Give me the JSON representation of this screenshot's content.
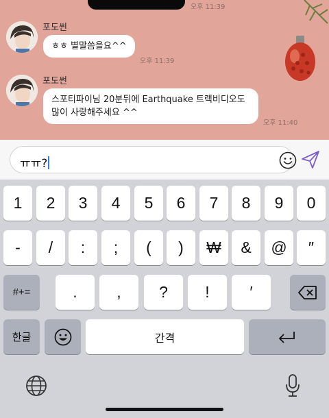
{
  "chat": {
    "top_time": "오후 11:39",
    "messages": [
      {
        "sender": "포도썬",
        "text": "ㅎㅎ 별말씀을요^^",
        "time": "오후 11:39"
      },
      {
        "sender": "포도썬",
        "line1": "스포티파이님 20분뒤에 Earthquake 트랙비디오도",
        "line2": "많이 사랑해주세요 ^^",
        "time": "오후 11:40"
      }
    ]
  },
  "input": {
    "value": "ㅠㅠ?"
  },
  "keyboard": {
    "row1": [
      "1",
      "2",
      "3",
      "4",
      "5",
      "6",
      "7",
      "8",
      "9",
      "0"
    ],
    "row2": [
      "-",
      "/",
      ":",
      ";",
      "(",
      ")",
      "₩",
      "&",
      "@",
      "″"
    ],
    "row3_mode": "#+=",
    "row3": [
      ".",
      ",",
      "?",
      "!",
      "′"
    ],
    "lang": "한글",
    "space": "간격"
  },
  "colors": {
    "chat_bg": "#e2a59a",
    "send_accent": "#7b61c9",
    "caret": "#3478f6"
  }
}
